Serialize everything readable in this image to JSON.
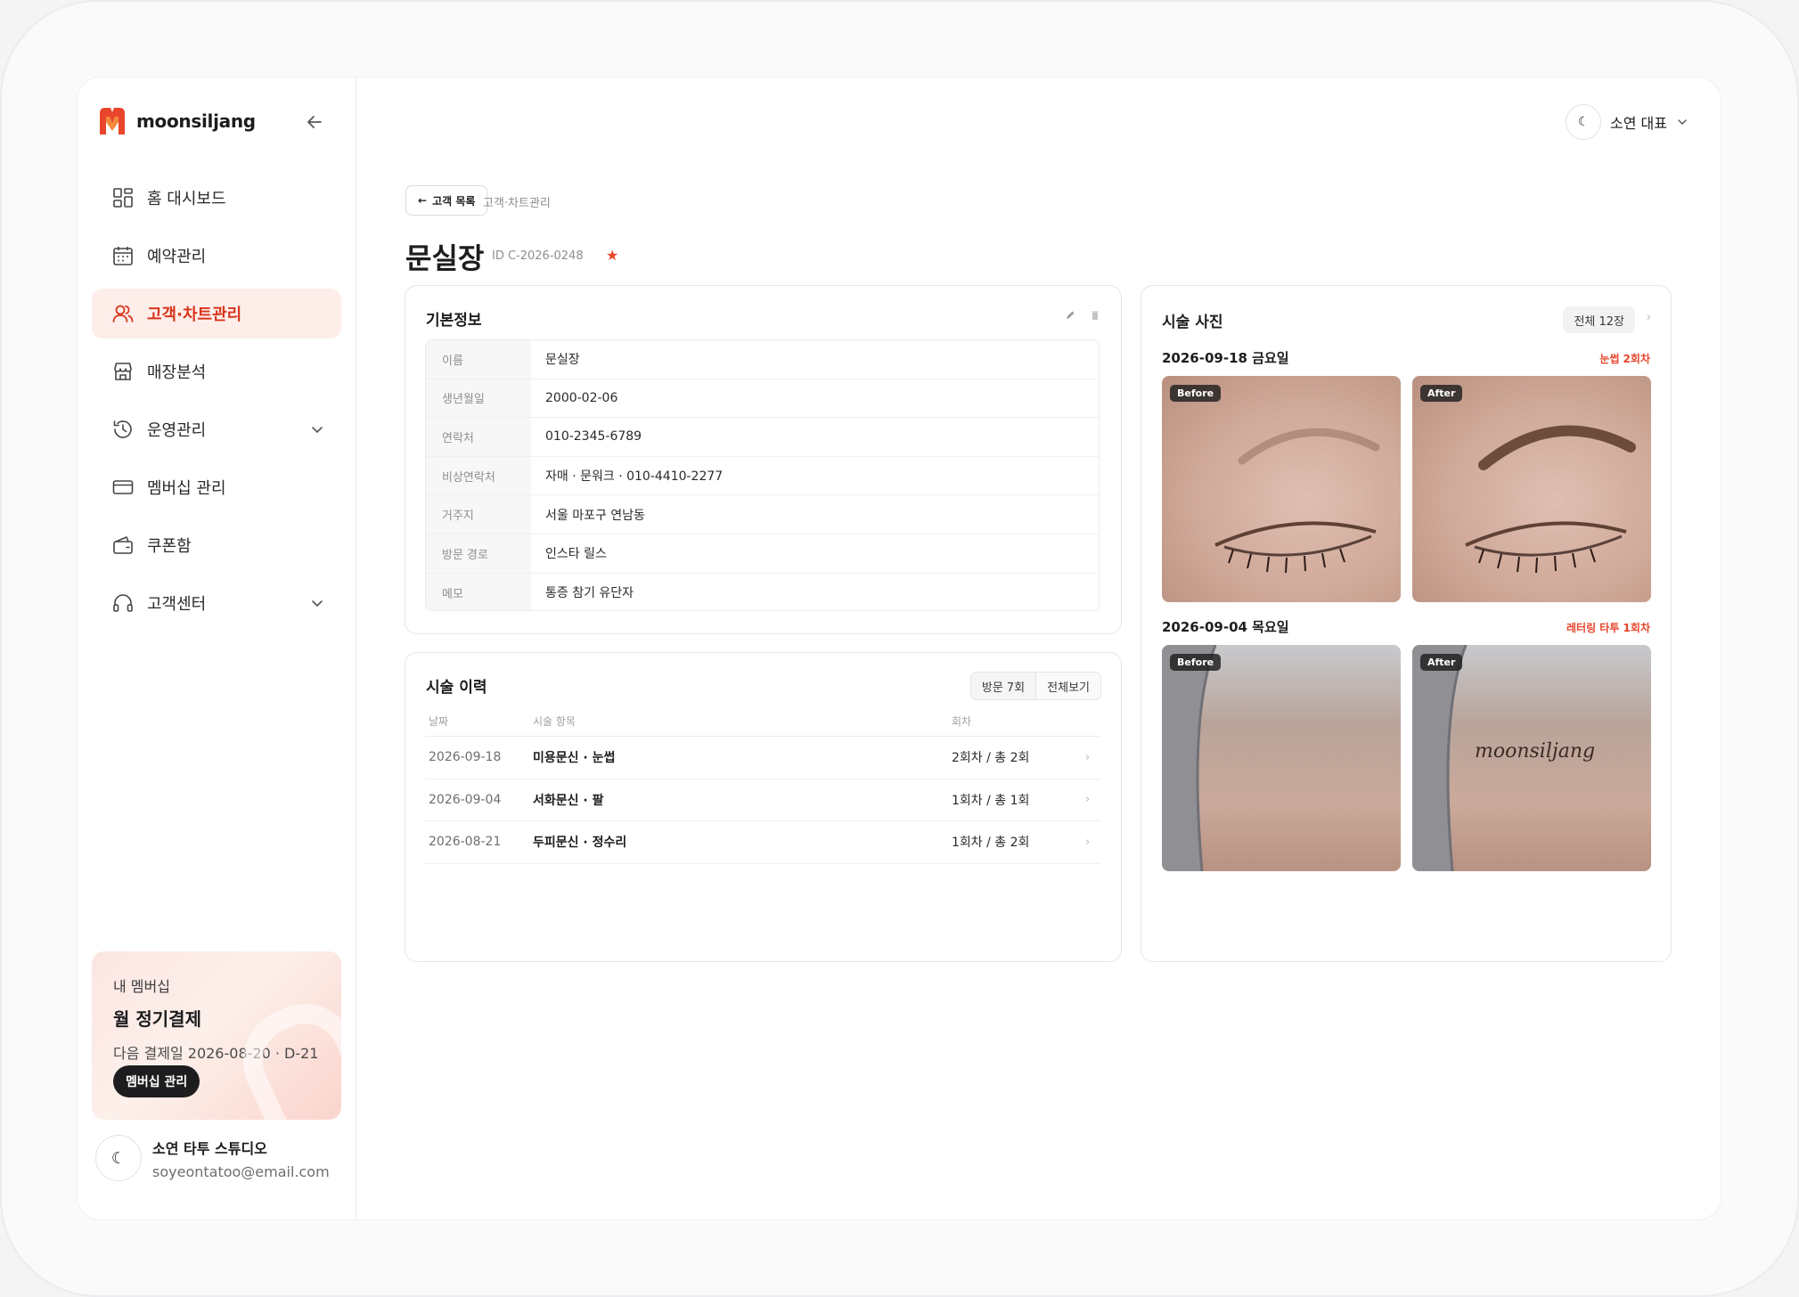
{
  "brand": {
    "name": "moonsiljang",
    "accent": "#e8452c",
    "accent_bg": "#fdeeea"
  },
  "sidebar": {
    "items": [
      {
        "label": "홈 대시보드",
        "icon": "dashboard-icon"
      },
      {
        "label": "예약관리",
        "icon": "calendar-icon"
      },
      {
        "label": "고객·차트관리",
        "icon": "users-icon",
        "active": true
      },
      {
        "label": "매장분석",
        "icon": "store-icon"
      },
      {
        "label": "운영관리",
        "icon": "history-icon",
        "expandable": true
      },
      {
        "label": "멤버십 관리",
        "icon": "card-icon"
      },
      {
        "label": "쿠폰함",
        "icon": "wallet-icon"
      },
      {
        "label": "고객센터",
        "icon": "headset-icon",
        "expandable": true
      }
    ],
    "membership": {
      "label": "내 멤버십",
      "title": "월 정기결제",
      "next": "다음 결제일 2026-08-20 · D-21",
      "button": "멤버십 관리"
    },
    "profile": {
      "name": "소연 타투 스튜디오",
      "email": "soyeontatoo@email.com"
    }
  },
  "header": {
    "user": "소연 대표"
  },
  "page": {
    "back_label": "고객 목록",
    "breadcrumb": "고객·차트관리",
    "title": "문실장",
    "customer_id": "ID C-2026-0248"
  },
  "basic_info": {
    "title": "기본정보",
    "rows": [
      {
        "label": "이름",
        "value": "문실장"
      },
      {
        "label": "생년월일",
        "value": "2000-02-06"
      },
      {
        "label": "연락처",
        "value": "010-2345-6789"
      },
      {
        "label": "비상연락처",
        "value": "자매 · 문워크 · 010-4410-2277"
      },
      {
        "label": "거주지",
        "value": "서울 마포구 연남동"
      },
      {
        "label": "방문 경로",
        "value": "인스타 릴스"
      },
      {
        "label": "메모",
        "value": "통증 참기 유단자"
      }
    ]
  },
  "history": {
    "title": "시술 이력",
    "visits": "방문 7회",
    "view_all": "전체보기",
    "columns": {
      "date": "날짜",
      "item": "시술 항목",
      "round": "회차"
    },
    "rows": [
      {
        "date": "2026-09-18",
        "item": "미용문신 · 눈썹",
        "round": "2회차 / 총 2회"
      },
      {
        "date": "2026-09-04",
        "item": "서화문신 · 팔",
        "round": "1회차 / 총 1회"
      },
      {
        "date": "2026-08-21",
        "item": "두피문신 · 정수리",
        "round": "1회차 / 총 2회"
      }
    ]
  },
  "photos": {
    "title": "시술 사진",
    "total": "전체 12장",
    "sessions": [
      {
        "date": "2026-09-18 금요일",
        "tag": "눈썹 2회차",
        "before": "Before",
        "after": "After"
      },
      {
        "date": "2026-09-04 목요일",
        "tag": "레터링 타투 1회차",
        "before": "Before",
        "after": "After",
        "lettering": "moonsiljang"
      }
    ]
  }
}
